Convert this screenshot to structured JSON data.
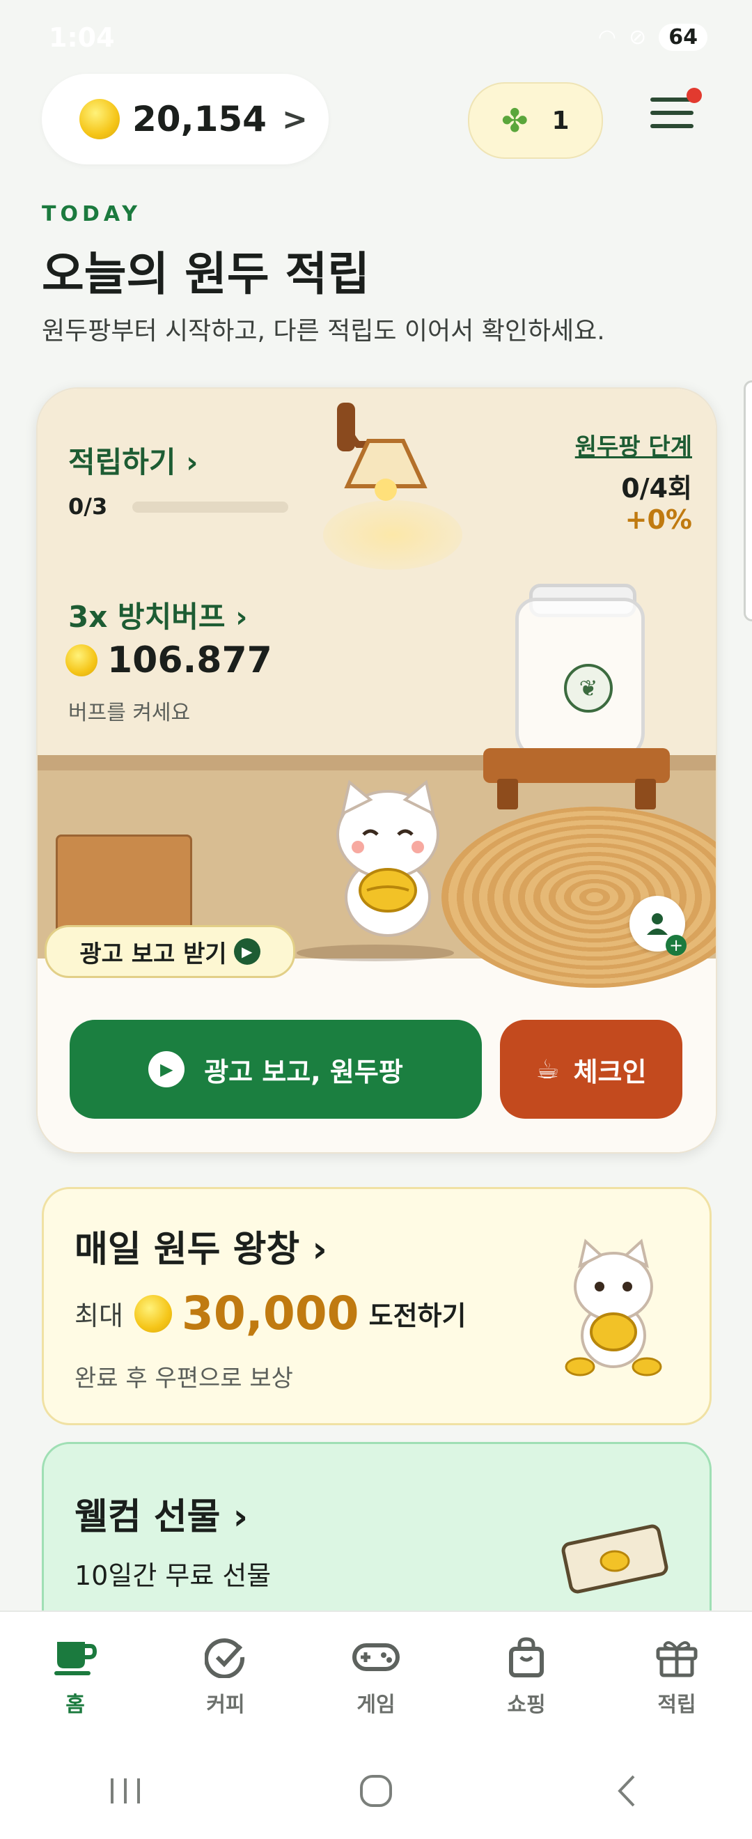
{
  "status_bar": {
    "time": "1:04",
    "battery": "64"
  },
  "topbar": {
    "coin_amount": "20,154",
    "coin_chevron": ">",
    "clover_count": "1"
  },
  "heading": {
    "eyebrow": "TODAY",
    "title": "오늘의 원두 적립",
    "subtitle": "원두팡부터 시작하고, 다른 적립도 이어서 확인하세요."
  },
  "main_card": {
    "collect_title": "적립하기 ›",
    "collect_progress": "0/3",
    "collect_fraction": 0,
    "stage_link": "원두팡 단계",
    "stage_count": "0/4회",
    "stage_pct": "+0%",
    "buff_title": "3x 방치버프 ›",
    "buff_amount": "106.877",
    "buff_sub": "버프를 켜세요",
    "ad_pill_label": "광고 보고 받기",
    "ad_button_label": "광고 보고, 원두팡",
    "checkin_label": "체크인"
  },
  "daily_card": {
    "title": "매일 원두 왕창 ›",
    "max_label": "최대",
    "amount": "30,000",
    "challenge": "도전하기",
    "sub": "완료 후 우편으로 보상"
  },
  "welcome_card": {
    "title": "웰컴 선물 ›",
    "sub": "10일간 무료 선물"
  },
  "bottom_nav": {
    "items": [
      {
        "label": "홈",
        "icon": "coffee-cup-icon",
        "active": true
      },
      {
        "label": "커피",
        "icon": "check-circle-icon",
        "active": false
      },
      {
        "label": "게임",
        "icon": "gamepad-icon",
        "active": false
      },
      {
        "label": "쇼핑",
        "icon": "shopping-bag-icon",
        "active": false
      },
      {
        "label": "적립",
        "icon": "gift-icon",
        "active": false
      }
    ]
  },
  "colors": {
    "brand_green": "#1b7f40",
    "checkin_orange": "#c34a1e",
    "coin_gold": "#f5c518",
    "amount_orange": "#c07a10"
  }
}
